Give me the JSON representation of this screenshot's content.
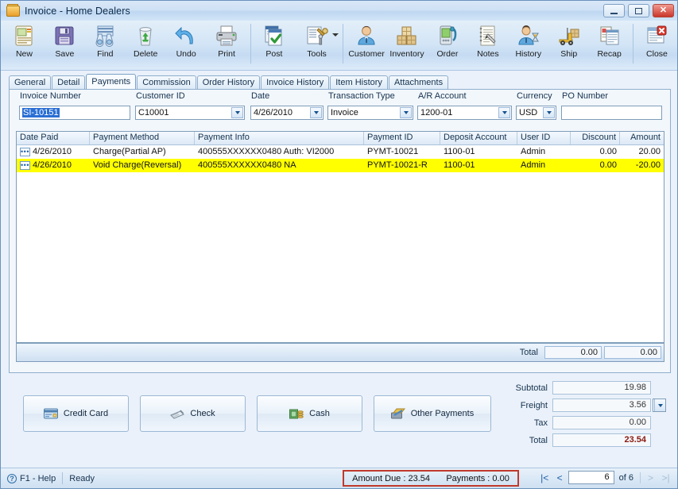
{
  "window": {
    "title": "Invoice - Home Dealers",
    "icon": "folder-icon",
    "minimize_label": "Minimize",
    "maximize_label": "Maximize",
    "close_label": "Close"
  },
  "toolbar": {
    "items": [
      {
        "label": "New",
        "icon": "new-document-icon"
      },
      {
        "label": "Save",
        "icon": "floppy-disk-icon"
      },
      {
        "label": "Find",
        "icon": "binoculars-icon"
      },
      {
        "label": "Delete",
        "icon": "recycle-bin-icon"
      },
      {
        "label": "Undo",
        "icon": "undo-arrow-icon"
      },
      {
        "label": "Print",
        "icon": "printer-icon"
      },
      {
        "label": "Post",
        "icon": "post-checkmark-icon"
      },
      {
        "label": "Tools",
        "icon": "tools-wrench-icon",
        "has_dropdown": true
      },
      {
        "label": "Customer",
        "icon": "customer-person-icon"
      },
      {
        "label": "Inventory",
        "icon": "inventory-boxes-icon"
      },
      {
        "label": "Order",
        "icon": "order-device-icon"
      },
      {
        "label": "Notes",
        "icon": "notes-pencil-icon"
      },
      {
        "label": "History",
        "icon": "history-person-hourglass-icon"
      },
      {
        "label": "Ship",
        "icon": "ship-forklift-icon"
      },
      {
        "label": "Recap",
        "icon": "recap-report-icon"
      },
      {
        "label": "Close",
        "icon": "close-window-icon"
      }
    ]
  },
  "tabs": [
    {
      "label": "General",
      "active": false
    },
    {
      "label": "Detail",
      "active": false
    },
    {
      "label": "Payments",
      "active": true
    },
    {
      "label": "Commission",
      "active": false
    },
    {
      "label": "Order History",
      "active": false
    },
    {
      "label": "Invoice History",
      "active": false
    },
    {
      "label": "Item History",
      "active": false
    },
    {
      "label": "Attachments",
      "active": false
    }
  ],
  "fields": {
    "invoice_number": {
      "label": "Invoice Number",
      "value": "SI-10151",
      "selected": true
    },
    "customer_id": {
      "label": "Customer ID",
      "value": "C10001"
    },
    "date": {
      "label": "Date",
      "value": "4/26/2010"
    },
    "transaction_type": {
      "label": "Transaction Type",
      "value": "Invoice"
    },
    "ar_account": {
      "label": "A/R Account",
      "value": "1200-01"
    },
    "currency": {
      "label": "Currency",
      "value": "USD"
    },
    "po_number": {
      "label": "PO Number",
      "value": "",
      "placeholder": ""
    }
  },
  "grid": {
    "columns": [
      {
        "label": "Date Paid",
        "align": "left"
      },
      {
        "label": "Payment Method",
        "align": "left"
      },
      {
        "label": "Payment Info",
        "align": "left"
      },
      {
        "label": "Payment ID",
        "align": "left"
      },
      {
        "label": "Deposit Account",
        "align": "left"
      },
      {
        "label": "User ID",
        "align": "left"
      },
      {
        "label": "Discount",
        "align": "right"
      },
      {
        "label": "Amount",
        "align": "right"
      }
    ],
    "rows": [
      {
        "selected": false,
        "date_paid": "4/26/2010",
        "payment_method": "Charge(Partial AP)",
        "payment_info": "400555XXXXXX0480 Auth: VI2000",
        "payment_id": "PYMT-10021",
        "deposit_account": "1100-01",
        "user_id": "Admin",
        "discount": "0.00",
        "amount": "20.00"
      },
      {
        "selected": true,
        "date_paid": "4/26/2010",
        "payment_method": "Void Charge(Reversal)",
        "payment_info": "400555XXXXXX0480 NA",
        "payment_id": "PYMT-10021-R",
        "deposit_account": "1100-01",
        "user_id": "Admin",
        "discount": "0.00",
        "amount": "-20.00"
      }
    ],
    "total": {
      "label": "Total",
      "discount": "0.00",
      "amount": "0.00"
    }
  },
  "payment_buttons": [
    {
      "label": "Credit Card",
      "icon": "credit-card-icon"
    },
    {
      "label": "Check",
      "icon": "check-icon"
    },
    {
      "label": "Cash",
      "icon": "cash-icon"
    },
    {
      "label": "Other Payments",
      "icon": "other-payments-icon"
    }
  ],
  "summary": {
    "subtotal": {
      "label": "Subtotal",
      "value": "19.98"
    },
    "freight": {
      "label": "Freight",
      "value": "3.56",
      "method": "N"
    },
    "tax": {
      "label": "Tax",
      "value": "0.00"
    },
    "total": {
      "label": "Total",
      "value": "23.54"
    }
  },
  "statusbar": {
    "help": "F1 - Help",
    "state": "Ready",
    "amount_due": "Amount Due : 23.54",
    "payments": "Payments : 0.00",
    "nav": {
      "first": "|<",
      "prev": "<",
      "page": "6",
      "of_label": "of 6",
      "next": ">",
      "last": ">|"
    }
  },
  "colors": {
    "accent": "#1d5fa8",
    "selected_row": "#ffff00",
    "total_red": "#8b1a10",
    "highlight_box": "#c0392b",
    "field_selection": "#2a6fd4"
  }
}
